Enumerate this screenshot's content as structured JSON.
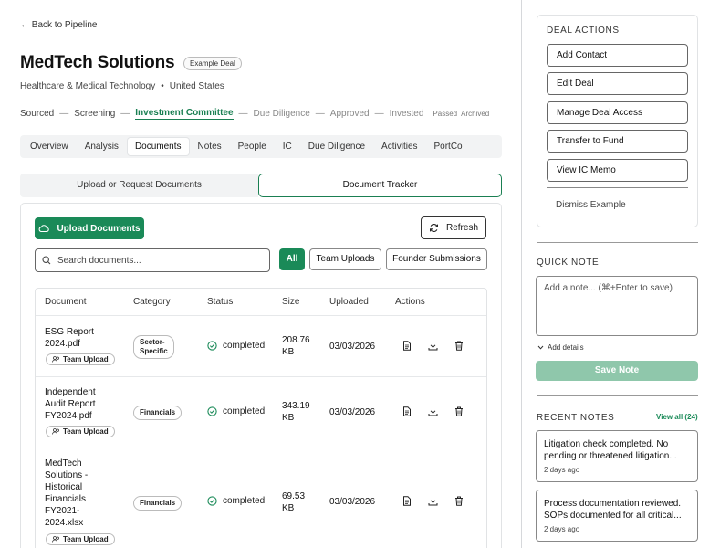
{
  "nav": {
    "back_label": "← Back to Pipeline"
  },
  "deal": {
    "name": "MedTech Solutions",
    "badge": "Example Deal",
    "industry": "Healthcare & Medical Technology",
    "separator": "•",
    "location": "United States"
  },
  "stages": {
    "items": [
      "Sourced",
      "Screening",
      "Investment Committee",
      "Due Diligence",
      "Approved",
      "Invested"
    ],
    "dash": "—",
    "extra": [
      "Passed",
      "Archived"
    ]
  },
  "tabs": [
    "Overview",
    "Analysis",
    "Documents",
    "Notes",
    "People",
    "IC",
    "Due Diligence",
    "Activities",
    "PortCo"
  ],
  "segments": {
    "upload": "Upload or Request Documents",
    "tracker": "Document Tracker"
  },
  "toolbar": {
    "upload_label": "Upload Documents",
    "refresh_label": "Refresh",
    "search_placeholder": "Search documents...",
    "filters": {
      "all": "All",
      "team": "Team Uploads",
      "founder": "Founder Submissions"
    }
  },
  "table": {
    "headers": {
      "document": "Document",
      "category": "Category",
      "status": "Status",
      "size": "Size",
      "uploaded": "Uploaded",
      "actions": "Actions"
    },
    "rows": [
      {
        "name_lines": [
          "ESG Report",
          "2024.pdf"
        ],
        "source": "Team Upload",
        "category_lines": [
          "Sector-",
          "Specific"
        ],
        "status": "completed",
        "size_lines": [
          "208.76",
          "KB"
        ],
        "uploaded": "03/03/2026"
      },
      {
        "name_lines": [
          "Independent",
          "Audit Report",
          "FY2024.pdf"
        ],
        "source": "Team Upload",
        "category_lines": [
          "Financials"
        ],
        "status": "completed",
        "size_lines": [
          "343.19",
          "KB"
        ],
        "uploaded": "03/03/2026"
      },
      {
        "name_lines": [
          "MedTech",
          "Solutions -",
          "Historical",
          "Financials",
          "FY2021-",
          "2024.xlsx"
        ],
        "source": "Team Upload",
        "category_lines": [
          "Financials"
        ],
        "status": "completed",
        "size_lines": [
          "69.53",
          "KB"
        ],
        "uploaded": "03/03/2026"
      }
    ]
  },
  "deal_actions": {
    "title": "DEAL ACTIONS",
    "buttons": [
      "Add Contact",
      "Edit Deal",
      "Manage Deal Access",
      "Transfer to Fund",
      "View IC Memo"
    ],
    "dismiss": "Dismiss Example"
  },
  "quick_note": {
    "title": "QUICK NOTE",
    "placeholder": "Add a note... (⌘+Enter to save)",
    "add_details": "Add details",
    "save_label": "Save Note"
  },
  "recent_notes": {
    "title": "RECENT NOTES",
    "view_all": "View all (24)",
    "items": [
      {
        "line1": "Litigation check completed. No",
        "line2": "pending or threatened litigation...",
        "date": "2 days ago"
      },
      {
        "line1": "Process documentation reviewed.",
        "line2": "SOPs documented for all critical...",
        "date": "2 days ago"
      }
    ]
  },
  "colors": {
    "accent": "#1a8a58",
    "accent_light": "#8fc7ab"
  }
}
